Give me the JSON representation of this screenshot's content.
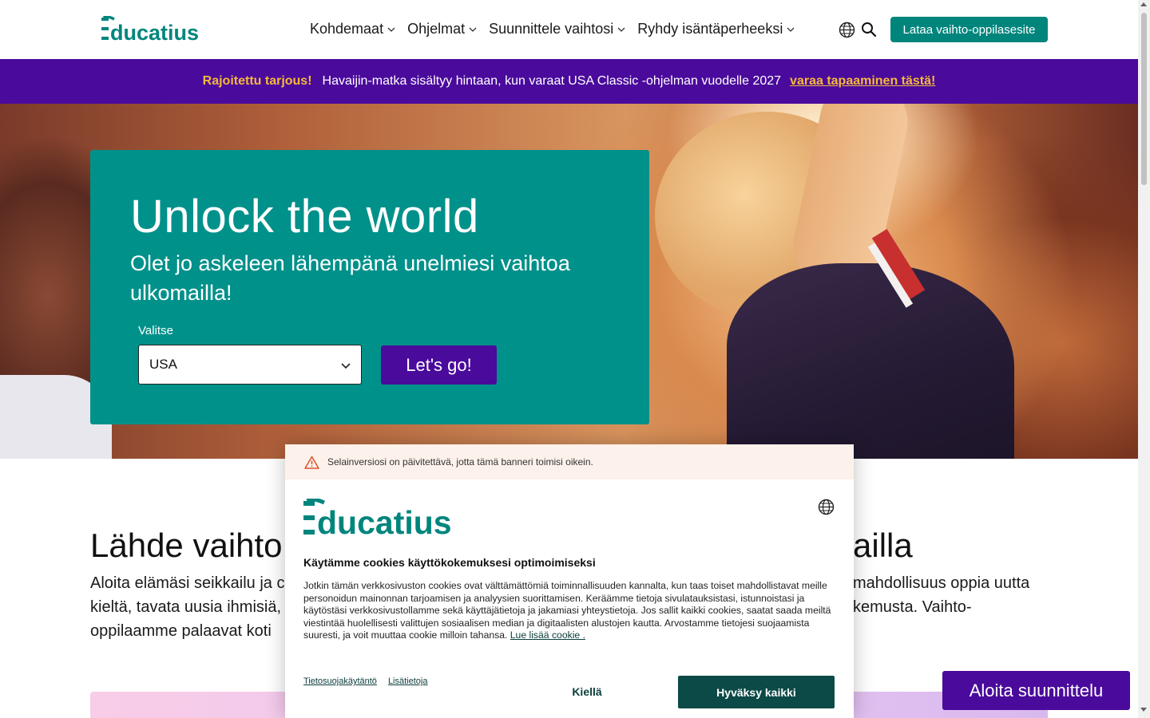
{
  "header": {
    "logo_text": "Educatius",
    "nav": [
      {
        "label": "Kohdemaat"
      },
      {
        "label": "Ohjelmat"
      },
      {
        "label": "Suunnittele vaihtosi"
      },
      {
        "label": "Ryhdy isäntäperheeksi"
      }
    ],
    "globe_icon": "globe-icon",
    "search_icon": "search-icon",
    "brochure_label": "Lataa vaihto-oppilasesite",
    "accent_color": "#00857d"
  },
  "promo": {
    "strong": "Rajoitettu tarjous!",
    "text": "Havaijin-matka sisältyy hintaan, kun varaat USA Classic -ohjelman vuodelle 2027",
    "link": "varaa tapaaminen tästä!",
    "background_color": "#4a0a9c",
    "highlight_color": "#f5b93a"
  },
  "hero": {
    "title": "Unlock the world",
    "subtitle": "Olet jo askeleen lähempänä unelmiesi vaihtoa ulkomailla!",
    "select_label": "Valitse",
    "select_value": "USA",
    "cta_label": "Let's go!",
    "card_color": "#00918a"
  },
  "intro": {
    "title_left": "Lähde vaihto",
    "title_right": "ailla",
    "line1_left": "Aloita elämäsi seikkailu ja c",
    "line1_right": "mahdollisuus oppia uutta",
    "line2_left": "kieltä, tavata uusia ihmisiä, ",
    "line2_right": "kemusta. Vaihto-",
    "line3_left": "oppilaamme palaavat koti"
  },
  "cookie": {
    "warning": "Selainversiosi on päivitettävä, jotta tämä banneri toimisi oikein.",
    "logo_text": "Educatius",
    "title": "Käytämme cookies käyttökokemuksesi optimoimiseksi",
    "body": "Jotkin tämän verkkosivuston cookies ovat välttämättömiä toiminnallisuuden kannalta, kun taas toiset mahdollistavat meille personoidun mainonnan tarjoamisen ja analyysien suorittamisen. Keräämme tietoja sivulatauksistasi, istunnoistasi ja käytöstäsi verkkosivustollamme sekä käyttäjätietoja ja jakamiasi yhteystietoja. Jos sallit kaikki cookies, saatat saada meiltä viestintää huolellisesti valittujen sosiaalisen median ja digitaalisten alustojen kautta. Arvostamme tietojesi suojaamista suuresti, ja voit muuttaa cookie milloin tahansa.",
    "read_more": "Lue lisää cookie .",
    "privacy_link": "Tietosuojakäytäntö",
    "details_link": "Lisätietoja",
    "deny_label": "Kiellä",
    "accept_label": "Hyväksy kaikki",
    "accept_color": "#0b4a46"
  },
  "floating": {
    "plan_label": "Aloita suunnittelu"
  }
}
